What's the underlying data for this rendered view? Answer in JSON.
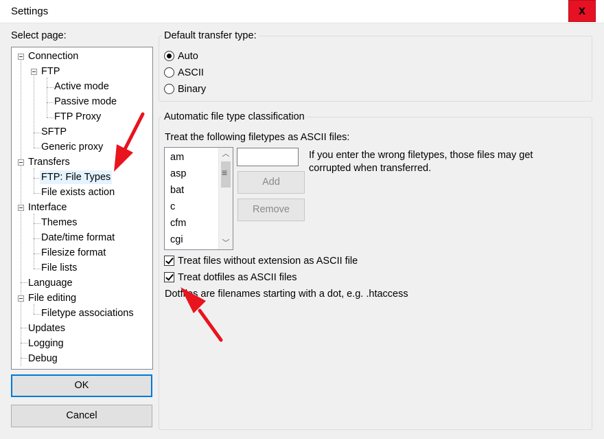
{
  "window": {
    "title": "Settings",
    "close_label": "x"
  },
  "sidebar": {
    "select_page_label": "Select page:",
    "tree": {
      "connection": "Connection",
      "ftp": "FTP",
      "active_mode": "Active mode",
      "passive_mode": "Passive mode",
      "ftp_proxy": "FTP Proxy",
      "sftp": "SFTP",
      "generic_proxy": "Generic proxy",
      "transfers": "Transfers",
      "ftp_file_types": "FTP: File Types",
      "file_exists_action": "File exists action",
      "interface": "Interface",
      "themes": "Themes",
      "datetime_format": "Date/time format",
      "filesize_format": "Filesize format",
      "file_lists": "File lists",
      "language": "Language",
      "file_editing": "File editing",
      "filetype_associations": "Filetype associations",
      "updates": "Updates",
      "logging": "Logging",
      "debug": "Debug"
    },
    "ok_label": "OK",
    "cancel_label": "Cancel"
  },
  "transfer_type": {
    "title": "Default transfer type:",
    "options": [
      "Auto",
      "ASCII",
      "Binary"
    ],
    "selected": "Auto"
  },
  "classification": {
    "title": "Automatic file type classification",
    "ascii_label": "Treat the following filetypes as ASCII files:",
    "filetypes": [
      "am",
      "asp",
      "bat",
      "c",
      "cfm",
      "cgi"
    ],
    "new_filetype_value": "",
    "add_label": "Add",
    "remove_label": "Remove",
    "warning_line1": "If you enter the wrong filetypes, those files may get",
    "warning_line2": "corrupted when transferred.",
    "no_extension_label": "Treat files without extension as ASCII file",
    "no_extension_checked": true,
    "dotfiles_label": "Treat dotfiles as ASCII files",
    "dotfiles_checked": true,
    "dotfiles_note": "Dotfiles are filenames starting with a dot, e.g. .htaccess"
  },
  "colors": {
    "selected_bg": "#e5f3ff",
    "annotation_arrow": "#e8141e",
    "close_bg": "#e81123"
  }
}
